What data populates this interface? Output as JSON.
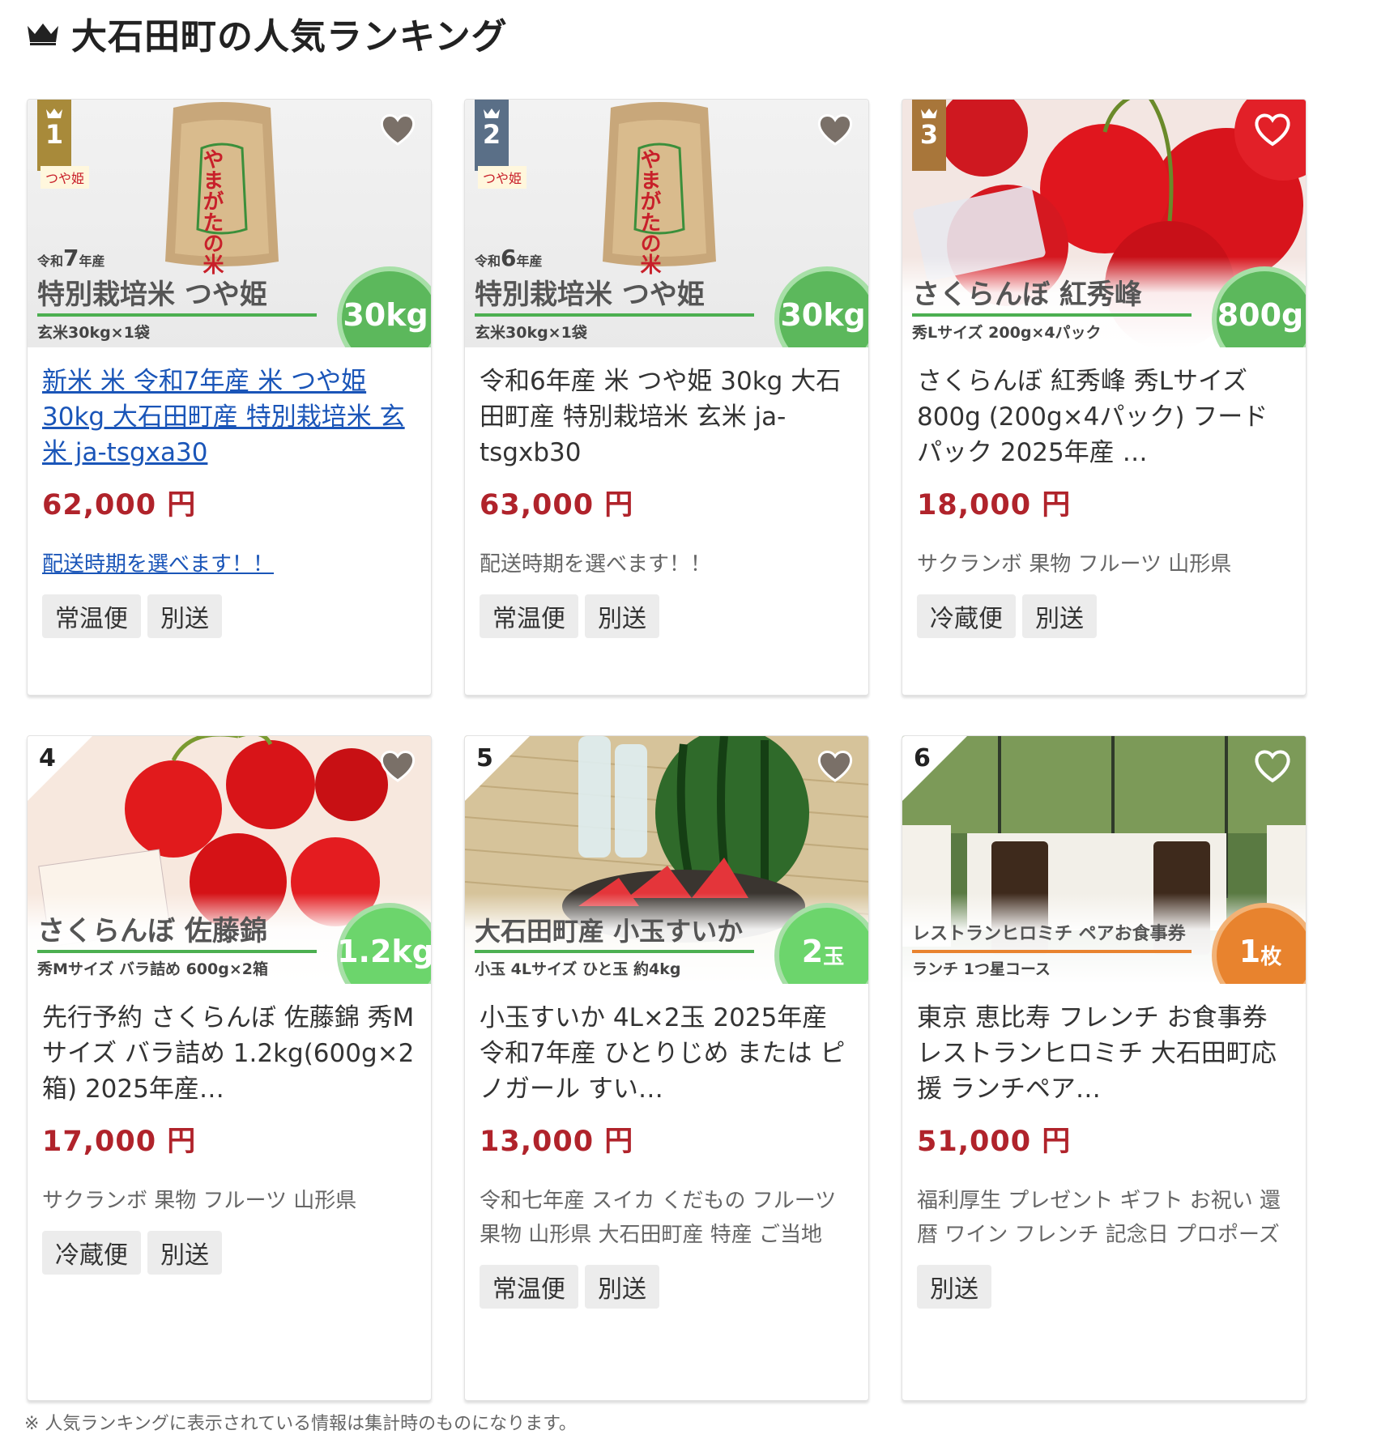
{
  "heading": {
    "title": "大石田町の人気ランキング",
    "icon": "crown-icon"
  },
  "cards": [
    {
      "rank": "1",
      "image": {
        "year_prefix": "令和",
        "year_num": "7",
        "year_suffix": "年産",
        "overlay_title": "特別栽培米 つや姫",
        "overlay_sub": "玄米30kg×1袋",
        "amount": "30kg",
        "bag_text": "やまがたの米",
        "brand": "つや姫"
      },
      "title": "新米 米 令和7年産 米 つや姫 30kg 大石田町産 特別栽培米 玄米 ja-tsgxa30",
      "price": "62,000 円",
      "tagline": "配送時期を選べます！！",
      "chips": [
        "常温便",
        "別送"
      ]
    },
    {
      "rank": "2",
      "image": {
        "year_prefix": "令和",
        "year_num": "6",
        "year_suffix": "年産",
        "overlay_title": "特別栽培米 つや姫",
        "overlay_sub": "玄米30kg×1袋",
        "amount": "30kg",
        "bag_text": "やまがたの米",
        "brand": "つや姫"
      },
      "title": "令和6年産 米 つや姫 30kg 大石田町産 特別栽培米 玄米 ja-tsgxb30",
      "price": "63,000 円",
      "tagline": "配送時期を選べます！！",
      "chips": [
        "常温便",
        "別送"
      ]
    },
    {
      "rank": "3",
      "image": {
        "overlay_title": "さくらんぼ 紅秀峰",
        "overlay_sub": "秀Lサイズ 200g×4パック",
        "amount": "800g"
      },
      "title": "さくらんぼ 紅秀峰 秀Lサイズ 800g (200g×4パック) フードパック 2025年産 …",
      "price": "18,000 円",
      "tagline": "サクランボ 果物 フルーツ 山形県",
      "chips": [
        "冷蔵便",
        "別送"
      ]
    },
    {
      "rank": "4",
      "image": {
        "overlay_title": "さくらんぼ 佐藤錦",
        "overlay_sub": "秀Mサイズ バラ詰め 600g×2箱",
        "amount": "1.2kg"
      },
      "title": "先行予約 さくらんぼ 佐藤錦 秀Mサイズ バラ詰め 1.2kg(600g×2箱) 2025年産…",
      "price": "17,000 円",
      "tagline": "サクランボ 果物 フルーツ 山形県",
      "chips": [
        "冷蔵便",
        "別送"
      ]
    },
    {
      "rank": "5",
      "image": {
        "overlay_title": "大石田町産 小玉すいか",
        "overlay_sub": "小玉 4Lサイズ ひと玉 約4kg",
        "amount_num": "2",
        "amount_unit": "玉"
      },
      "title": "小玉すいか 4L×2玉 2025年産 令和7年産 ひとりじめ または ピノガール すい…",
      "price": "13,000 円",
      "tagline": "令和七年産 スイカ くだもの フルーツ 果物 山形県 大石田町産 特産 ご当地",
      "chips": [
        "常温便",
        "別送"
      ]
    },
    {
      "rank": "6",
      "image": {
        "overlay_title": "レストランヒロミチ ペアお食事券",
        "overlay_sub": "ランチ 1つ星コース",
        "amount_num": "1",
        "amount_unit": "枚"
      },
      "title": "東京 恵比寿 フレンチ お食事券 レストランヒロミチ 大石田町応援 ランチペア…",
      "price": "51,000 円",
      "tagline": "福利厚生 プレゼント ギフト お祝い 還暦 ワイン フレンチ 記念日 プロポーズ",
      "chips": [
        "別送"
      ]
    }
  ],
  "footnote": "※ 人気ランキングに表示されている情報は集計時のものになります。",
  "colors": {
    "price": "#b0232b",
    "link": "#1a55b8",
    "green": "#5cb85c",
    "orange": "#e8832e",
    "gold": "#a88a3a",
    "slate": "#5a6f87",
    "bronze": "#a8763a"
  }
}
